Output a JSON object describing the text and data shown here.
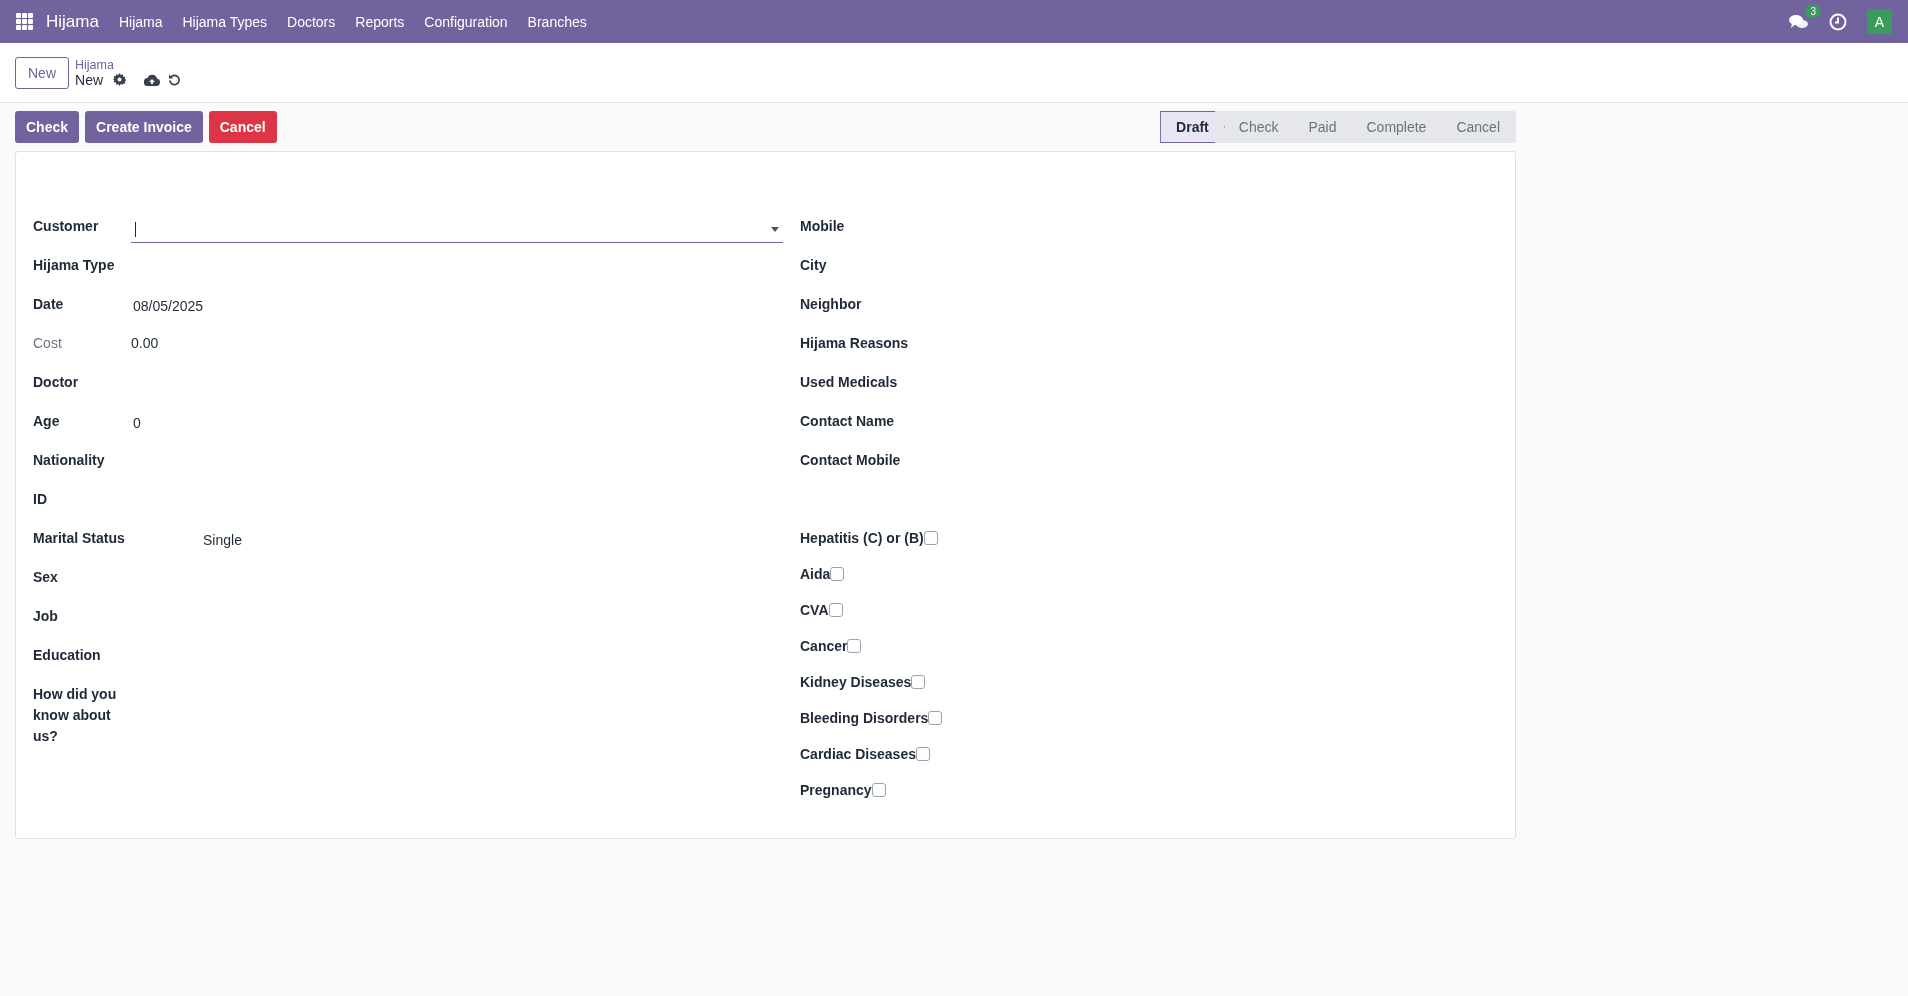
{
  "navbar": {
    "app_name": "Hijama",
    "menu": [
      "Hijama",
      "Hijama Types",
      "Doctors",
      "Reports",
      "Configuration",
      "Branches"
    ],
    "message_count": "3",
    "user_initial": "A"
  },
  "control_panel": {
    "new_button": "New",
    "breadcrumb": "Hijama",
    "record_name": "New"
  },
  "actions": [
    {
      "label": "Check",
      "kind": "primary"
    },
    {
      "label": "Create Invoice",
      "kind": "primary"
    },
    {
      "label": "Cancel",
      "kind": "danger"
    }
  ],
  "statusbar": [
    {
      "label": "Draft",
      "selected": true
    },
    {
      "label": "Check",
      "selected": false
    },
    {
      "label": "Paid",
      "selected": false
    },
    {
      "label": "Complete",
      "selected": false
    },
    {
      "label": "Cancel",
      "selected": false
    }
  ],
  "left_fields": [
    {
      "label": "Customer",
      "kind": "many2one"
    },
    {
      "label": "Hijama Type",
      "kind": "field"
    },
    {
      "label": "Date",
      "kind": "field",
      "value": "08/05/2025"
    },
    {
      "label": "Cost",
      "kind": "readonly",
      "value": "0.00"
    },
    {
      "label": "Doctor",
      "kind": "field"
    },
    {
      "label": "Age",
      "kind": "field",
      "value": "0"
    },
    {
      "label": "Nationality",
      "kind": "field"
    },
    {
      "label": "ID",
      "kind": "field"
    },
    {
      "label": "Marital Status",
      "kind": "selection",
      "value": "Single"
    },
    {
      "label": "Sex",
      "kind": "field"
    },
    {
      "label": "Job",
      "kind": "field"
    },
    {
      "label": "Education",
      "kind": "field"
    },
    {
      "label": "How did you know about us?",
      "kind": "field"
    }
  ],
  "right_fields": [
    {
      "label": "Mobile"
    },
    {
      "label": "City"
    },
    {
      "label": "Neighbor"
    },
    {
      "label": "Hijama Reasons"
    },
    {
      "label": "Used Medicals"
    },
    {
      "label": "Contact Name"
    },
    {
      "label": "Contact Mobile"
    }
  ],
  "conditions": [
    {
      "label": "Hepatitis (C) or (B)",
      "checked": false
    },
    {
      "label": "Aida",
      "checked": false
    },
    {
      "label": "CVA",
      "checked": false
    },
    {
      "label": "Cancer",
      "checked": false
    },
    {
      "label": "Kidney Diseases",
      "checked": false
    },
    {
      "label": "Bleeding Disorders",
      "checked": false
    },
    {
      "label": "Cardiac Diseases",
      "checked": false
    },
    {
      "label": "Pregnancy",
      "checked": false
    }
  ]
}
